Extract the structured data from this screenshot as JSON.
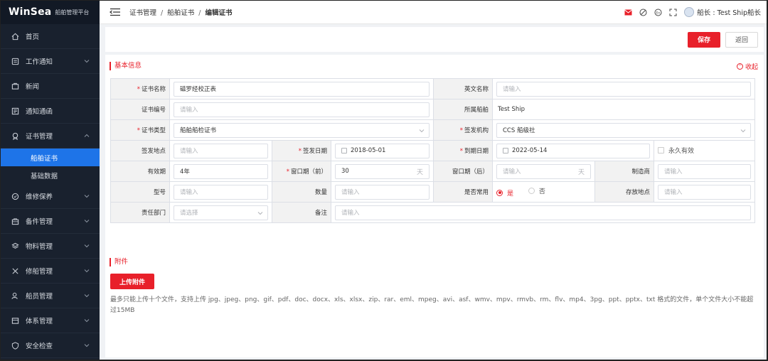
{
  "app": {
    "brand": "WinSea",
    "subtitle": "船舶管理平台"
  },
  "sidebar": {
    "items": [
      {
        "label": "首页",
        "icon": "home-icon"
      },
      {
        "label": "工作通知",
        "icon": "notice-icon"
      },
      {
        "label": "新闻",
        "icon": "news-icon"
      },
      {
        "label": "通知通函",
        "icon": "circular-icon"
      },
      {
        "label": "证书管理",
        "icon": "certificate-icon"
      },
      {
        "label": "维修保养",
        "icon": "maintenance-icon"
      },
      {
        "label": "备件管理",
        "icon": "spare-parts-icon"
      },
      {
        "label": "物料管理",
        "icon": "materials-icon"
      },
      {
        "label": "修船管理",
        "icon": "repair-icon"
      },
      {
        "label": "船员管理",
        "icon": "crew-icon"
      },
      {
        "label": "体系管理",
        "icon": "system-icon"
      },
      {
        "label": "安全检查",
        "icon": "safety-icon"
      }
    ],
    "sub_items": [
      {
        "label": "船舶证书"
      },
      {
        "label": "基础数据"
      }
    ]
  },
  "breadcrumb": {
    "level1": "证书管理",
    "level2": "船舶证书",
    "current": "编辑证书",
    "sep": "/"
  },
  "user": {
    "name": "船长 : Test Ship船长"
  },
  "toolbar": {
    "save": "保存",
    "back": "返回"
  },
  "section_basic": {
    "title": "基本信息",
    "collapse": "收起"
  },
  "form": {
    "cert_name_label": "证书名称",
    "cert_name_value": "磁罗经校正表",
    "en_name_label": "英文名称",
    "en_name_placeholder": "请输入",
    "cert_no_label": "证书编号",
    "cert_no_placeholder": "请输入",
    "ship_label": "所属船舶",
    "ship_value": "Test Ship",
    "cert_type_label": "证书类型",
    "cert_type_value": "船舶船检证书",
    "issuer_label": "签发机构",
    "issuer_value": "CCS 船级社",
    "issue_place_label": "签发地点",
    "issue_place_placeholder": "请输入",
    "issue_date_label": "签发日期",
    "issue_date_value": "2018-05-01",
    "expiry_label": "到期日期",
    "expiry_value": "2022-05-14",
    "permanent_label": "永久有效",
    "validity_label": "有效期",
    "validity_value": "4年",
    "window_before_label": "窗口期（前）",
    "window_before_value": "30",
    "day_unit": "天",
    "window_after_label": "窗口期（后）",
    "window_after_placeholder": "请输入",
    "maker_label": "制造商",
    "maker_placeholder": "请输入",
    "model_label": "型号",
    "model_placeholder": "请输入",
    "qty_label": "数量",
    "qty_placeholder": "请输入",
    "common_label": "是否常用",
    "yes": "是",
    "no": "否",
    "storage_label": "存放地点",
    "storage_placeholder": "请输入",
    "dept_label": "责任部门",
    "dept_placeholder": "请选择",
    "remark_label": "备注",
    "remark_placeholder": "请输入",
    "required_mark": "*"
  },
  "section_attach": {
    "title": "附件",
    "upload": "上传附件",
    "note": "最多只能上传十个文件，支持上传 jpg、jpeg、png、gif、pdf、doc、docx、xls、xlsx、zip、rar、eml、mpeg、avi、asf、wmv、mpv、rmvb、rm、flv、mp4、3pg、ppt、pptx、txt 格式的文件，单个文件大小不能超过15MB"
  },
  "colors": {
    "accent": "#e8202a",
    "sidebar_bg": "#19212e",
    "active_blue": "#1e74e8"
  }
}
